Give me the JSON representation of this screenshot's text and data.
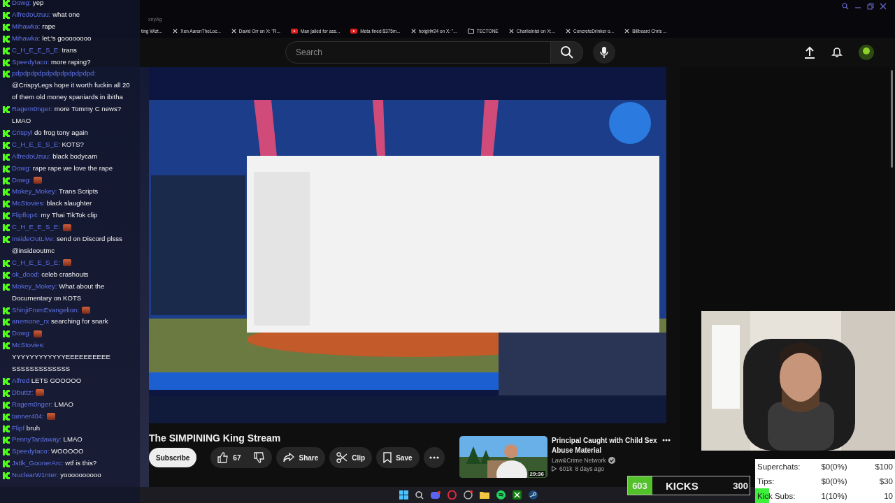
{
  "browser": {
    "address_fragment": "xnyAg",
    "bookmarks": [
      {
        "kind": "plain",
        "label": "ting Wizt..."
      },
      {
        "kind": "x",
        "label": "Xen AaronTheLoc..."
      },
      {
        "kind": "x",
        "label": "David Orr on X: \"R..."
      },
      {
        "kind": "video",
        "label": "Man jailed for ass..."
      },
      {
        "kind": "video",
        "label": "Meta fined $375m..."
      },
      {
        "kind": "x",
        "label": "hotgirl#24 on X: \"..."
      },
      {
        "kind": "folder",
        "label": "TECTONE"
      },
      {
        "kind": "x",
        "label": "CharlieIntel on X:..."
      },
      {
        "kind": "x",
        "label": "ConcreteDrinker o..."
      },
      {
        "kind": "x",
        "label": "Billboard Chris ..."
      }
    ]
  },
  "header": {
    "search": {
      "placeholder": "Search"
    }
  },
  "video": {
    "kind": "picture",
    "title": "The SIMPINING King Stream",
    "subscribe": "Subscribe",
    "actions": [
      {
        "kind": "like",
        "label": "67"
      },
      {
        "kind": "dislike"
      },
      {
        "kind": "share",
        "label": "Share"
      },
      {
        "kind": "clip",
        "label": "Clip"
      },
      {
        "kind": "save",
        "label": "Save"
      },
      {
        "kind": "more"
      }
    ]
  },
  "recommended": {
    "title": "Principal Caught with Child Sex Abuse Material",
    "channel": "Law&Crime Network",
    "verified": true,
    "views": "601k",
    "age": "8 days ago",
    "duration": "29:36"
  },
  "chat": [
    {
      "user": "Dowg:",
      "kind": "text",
      "text": "yep"
    },
    {
      "user": "AlfredoUzuu:",
      "kind": "text",
      "text": "what one"
    },
    {
      "user": "Mihawka:",
      "kind": "text",
      "text": "rape"
    },
    {
      "user": "Mihawka:",
      "kind": "text",
      "text": "let;'s goooooooo"
    },
    {
      "user": "C_H_E_E_S_E:",
      "kind": "text",
      "text": "trans"
    },
    {
      "user": "Speedytaco:",
      "kind": "text",
      "text": "more raping?"
    },
    {
      "user": "pdpdpdpdpdpdpdpdpdpdpd:",
      "kind": "text",
      "text": "@CrispyLegs hope it worth fuckin all 20 of them old money spaniards in ibitha"
    },
    {
      "user": "Ragem0nger:",
      "kind": "text",
      "text": "more Tommy C news? LMAO"
    },
    {
      "user": "Crispyl",
      "kind": "text",
      "text": "do frog tony again"
    },
    {
      "user": "C_H_E_E_S_E:",
      "kind": "text",
      "text": "KOTS?"
    },
    {
      "user": "AlfredoUzuu:",
      "kind": "text",
      "text": "black bodycam"
    },
    {
      "user": "Dowg:",
      "kind": "text",
      "text": "rape rape we love the rape"
    },
    {
      "user": "Dowg:",
      "kind": "emote"
    },
    {
      "user": "Mokey_Mokey:",
      "kind": "text",
      "text": "Trans Scripts"
    },
    {
      "user": "McStovies:",
      "kind": "text",
      "text": "black slaughter"
    },
    {
      "user": "Flipflop4:",
      "kind": "text",
      "text": "my Thai TikTok clip"
    },
    {
      "user": "C_H_E_E_S_E:",
      "kind": "emote"
    },
    {
      "user": "InsideOutLive:",
      "kind": "text",
      "text": "send on Discord plsss @insideoutmc"
    },
    {
      "user": "C_H_E_E_S_E:",
      "kind": "emote"
    },
    {
      "user": "ok_dood:",
      "kind": "text",
      "text": "celeb crashouts"
    },
    {
      "user": "Mokey_Mokey:",
      "kind": "text",
      "text": "What about the Documentary on KOTS"
    },
    {
      "user": "ShinjiFromEvangelion:",
      "kind": "emote"
    },
    {
      "user": "anemone_rx",
      "kind": "text",
      "text": "searching for snark"
    },
    {
      "user": "Dowg:",
      "kind": "emote"
    },
    {
      "user": "McStovies:",
      "kind": "text",
      "text": "YYYYYYYYYYYYEEEEEEEEEE SSSSSSSSSSSSS"
    },
    {
      "user": "Alfred",
      "kind": "text",
      "text": "LETS GOOOOO"
    },
    {
      "user": "Dbuttz:",
      "kind": "emote"
    },
    {
      "user": "Ragem0nger:",
      "kind": "text",
      "text": "LMAO"
    },
    {
      "user": "tanner404:",
      "kind": "emote"
    },
    {
      "user": "Flipf",
      "kind": "text",
      "text": "bruh"
    },
    {
      "user": "PennyTardaway:",
      "kind": "text",
      "text": "LMAO"
    },
    {
      "user": "Speedytaco:",
      "kind": "text",
      "text": "WOOOOO"
    },
    {
      "user": "Jstlk_GoonerArc:",
      "kind": "text",
      "text": "wtf is this?"
    },
    {
      "user": "NuclearW1nter:",
      "kind": "text",
      "text": "yoooooooooo"
    }
  ],
  "kicks": {
    "count": "603",
    "label": "KICKS",
    "goal": "300",
    "level": 0.2
  },
  "stats": [
    {
      "label": "Superchats:",
      "value": "$0(0%)",
      "goal": "$100"
    },
    {
      "label": "Tips:",
      "value": "$0(0%)",
      "goal": "$30"
    },
    {
      "label": "Kick Subs:",
      "value": "1(10%)",
      "goal": "10",
      "level": 0.1
    }
  ],
  "taskbar": [
    {
      "kind": "windows"
    },
    {
      "kind": "search"
    },
    {
      "kind": "chat"
    },
    {
      "kind": "ring"
    },
    {
      "kind": "globe"
    },
    {
      "kind": "folder"
    },
    {
      "kind": "music"
    },
    {
      "kind": "game"
    },
    {
      "kind": "steam"
    }
  ]
}
